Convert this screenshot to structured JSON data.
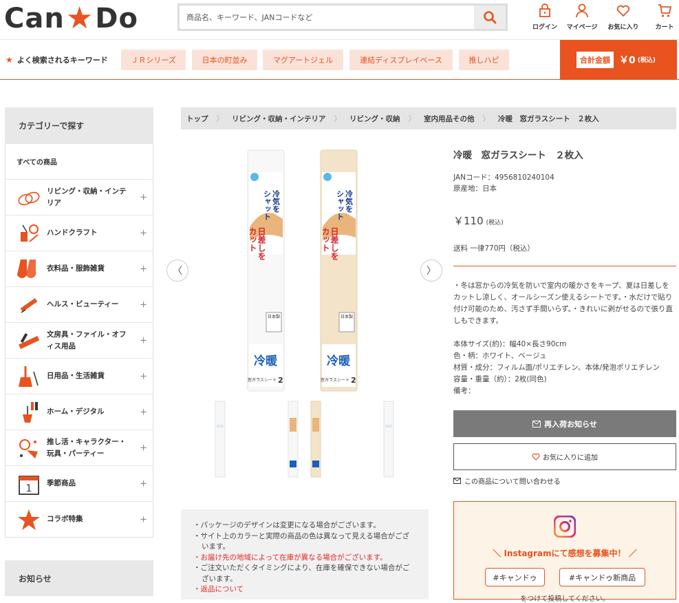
{
  "header": {
    "logo_left": "Can",
    "logo_star": "★",
    "logo_right": "Do",
    "search_placeholder": "商品名、キーワード、JANコードなど",
    "icons": [
      {
        "label": "ログイン",
        "icon": "lock-icon"
      },
      {
        "label": "マイページ",
        "icon": "user-icon"
      },
      {
        "label": "お気に入り",
        "icon": "heart-icon"
      },
      {
        "label": "カート",
        "icon": "cart-icon"
      }
    ]
  },
  "keywords": {
    "label": "よく検索されるキーワード",
    "items": [
      "ＪＲシリーズ",
      "日本の町並み",
      "マグアートジェル",
      "連結ディスプレイベース",
      "推しハピ"
    ]
  },
  "cart_total": {
    "label": "合計金額",
    "value": "￥0",
    "tax": "(税込)"
  },
  "sidebar": {
    "title": "カテゴリーで探す",
    "all": "すべての商品",
    "items": [
      {
        "label": "リビング・収納・インテリア",
        "icon": "sofa-icon"
      },
      {
        "label": "ハンドクラフト",
        "icon": "craft-icon"
      },
      {
        "label": "衣料品・服飾雑貨",
        "icon": "socks-icon"
      },
      {
        "label": "ヘルス・ビューティー",
        "icon": "comb-icon"
      },
      {
        "label": "文房具・ファイル・オフィス用品",
        "icon": "stationery-icon"
      },
      {
        "label": "日用品・生活雑貨",
        "icon": "broom-icon"
      },
      {
        "label": "ホーム・デジタル",
        "icon": "tools-icon"
      },
      {
        "label": "推し活・キャラクター・玩具・パーティー",
        "icon": "party-icon"
      },
      {
        "label": "季節商品",
        "icon": "calendar-icon"
      },
      {
        "label": "コラボ特集",
        "icon": "star-icon"
      }
    ],
    "news_title": "お知らせ"
  },
  "breadcrumb": [
    "トップ",
    "リビング・収納・インテリア",
    "リビング・収納",
    "室内用品その他",
    "冷暖　窓ガラスシート　２枚入"
  ],
  "product": {
    "title": "冷暖　窓ガラスシート　２枚入",
    "jan": "JANコード：4956810240104",
    "origin": "原産地：日本",
    "price": "￥110",
    "price_tax": "(税込)",
    "shipping": "送料 一律770円（税込）",
    "description": "・冬は窓からの冷気を防いで室内の暖かさをキープ、夏は日差しをカットし涼しく、オールシーズン使えるシートです。・水だけで貼り付け可能のため、汚さず手間いらず。・きれいに剥がせるので張り直しもできます。",
    "specs": [
      "本体サイズ(約)：幅40×長さ90cm",
      "色・柄：ホワイト、ベージュ",
      "材質・成分：フィルム面/ポリエチレン、本体/発泡ポリエチレン",
      "容量・重量（約）：2枚(同色)",
      "備考："
    ],
    "restock_button": "再入荷お知らせ",
    "favorite_button": "お気に入りに追加",
    "inquiry": "この商品について問い合わせる",
    "package_text": "冷暖",
    "package_sub": "窓ガラスシート",
    "package_count": "2",
    "package_badge": "日本製",
    "package_catch1": "冷気を",
    "package_catch2": "シャット",
    "package_catch3": "日差しを",
    "package_catch4": "カット"
  },
  "notes": [
    {
      "text": "・パッケージのデザインは変更になる場合がございます。",
      "red": false
    },
    {
      "text": "・サイト上のカラーと実際の商品の色は異なって見える場合がございます。",
      "red": false
    },
    {
      "text": "・お届け先の地域によって在庫が異なる場合がございます。",
      "red": true
    },
    {
      "text": "・ご注文いただくタイミングにより、在庫を確保できない場合がございます。",
      "red": false
    },
    {
      "text": "・返品について",
      "red": true
    }
  ],
  "instagram": {
    "title": "＼ Instagramにて感想を募集中！ ／",
    "tag1": "#キャンドゥ",
    "tag2": "#キャンドゥ新商品",
    "post": "をつけて投稿してください。"
  },
  "colors": {
    "accent": "#e8531f",
    "accent_light": "#fbe2d9",
    "gray_button": "#7a7a7a"
  }
}
